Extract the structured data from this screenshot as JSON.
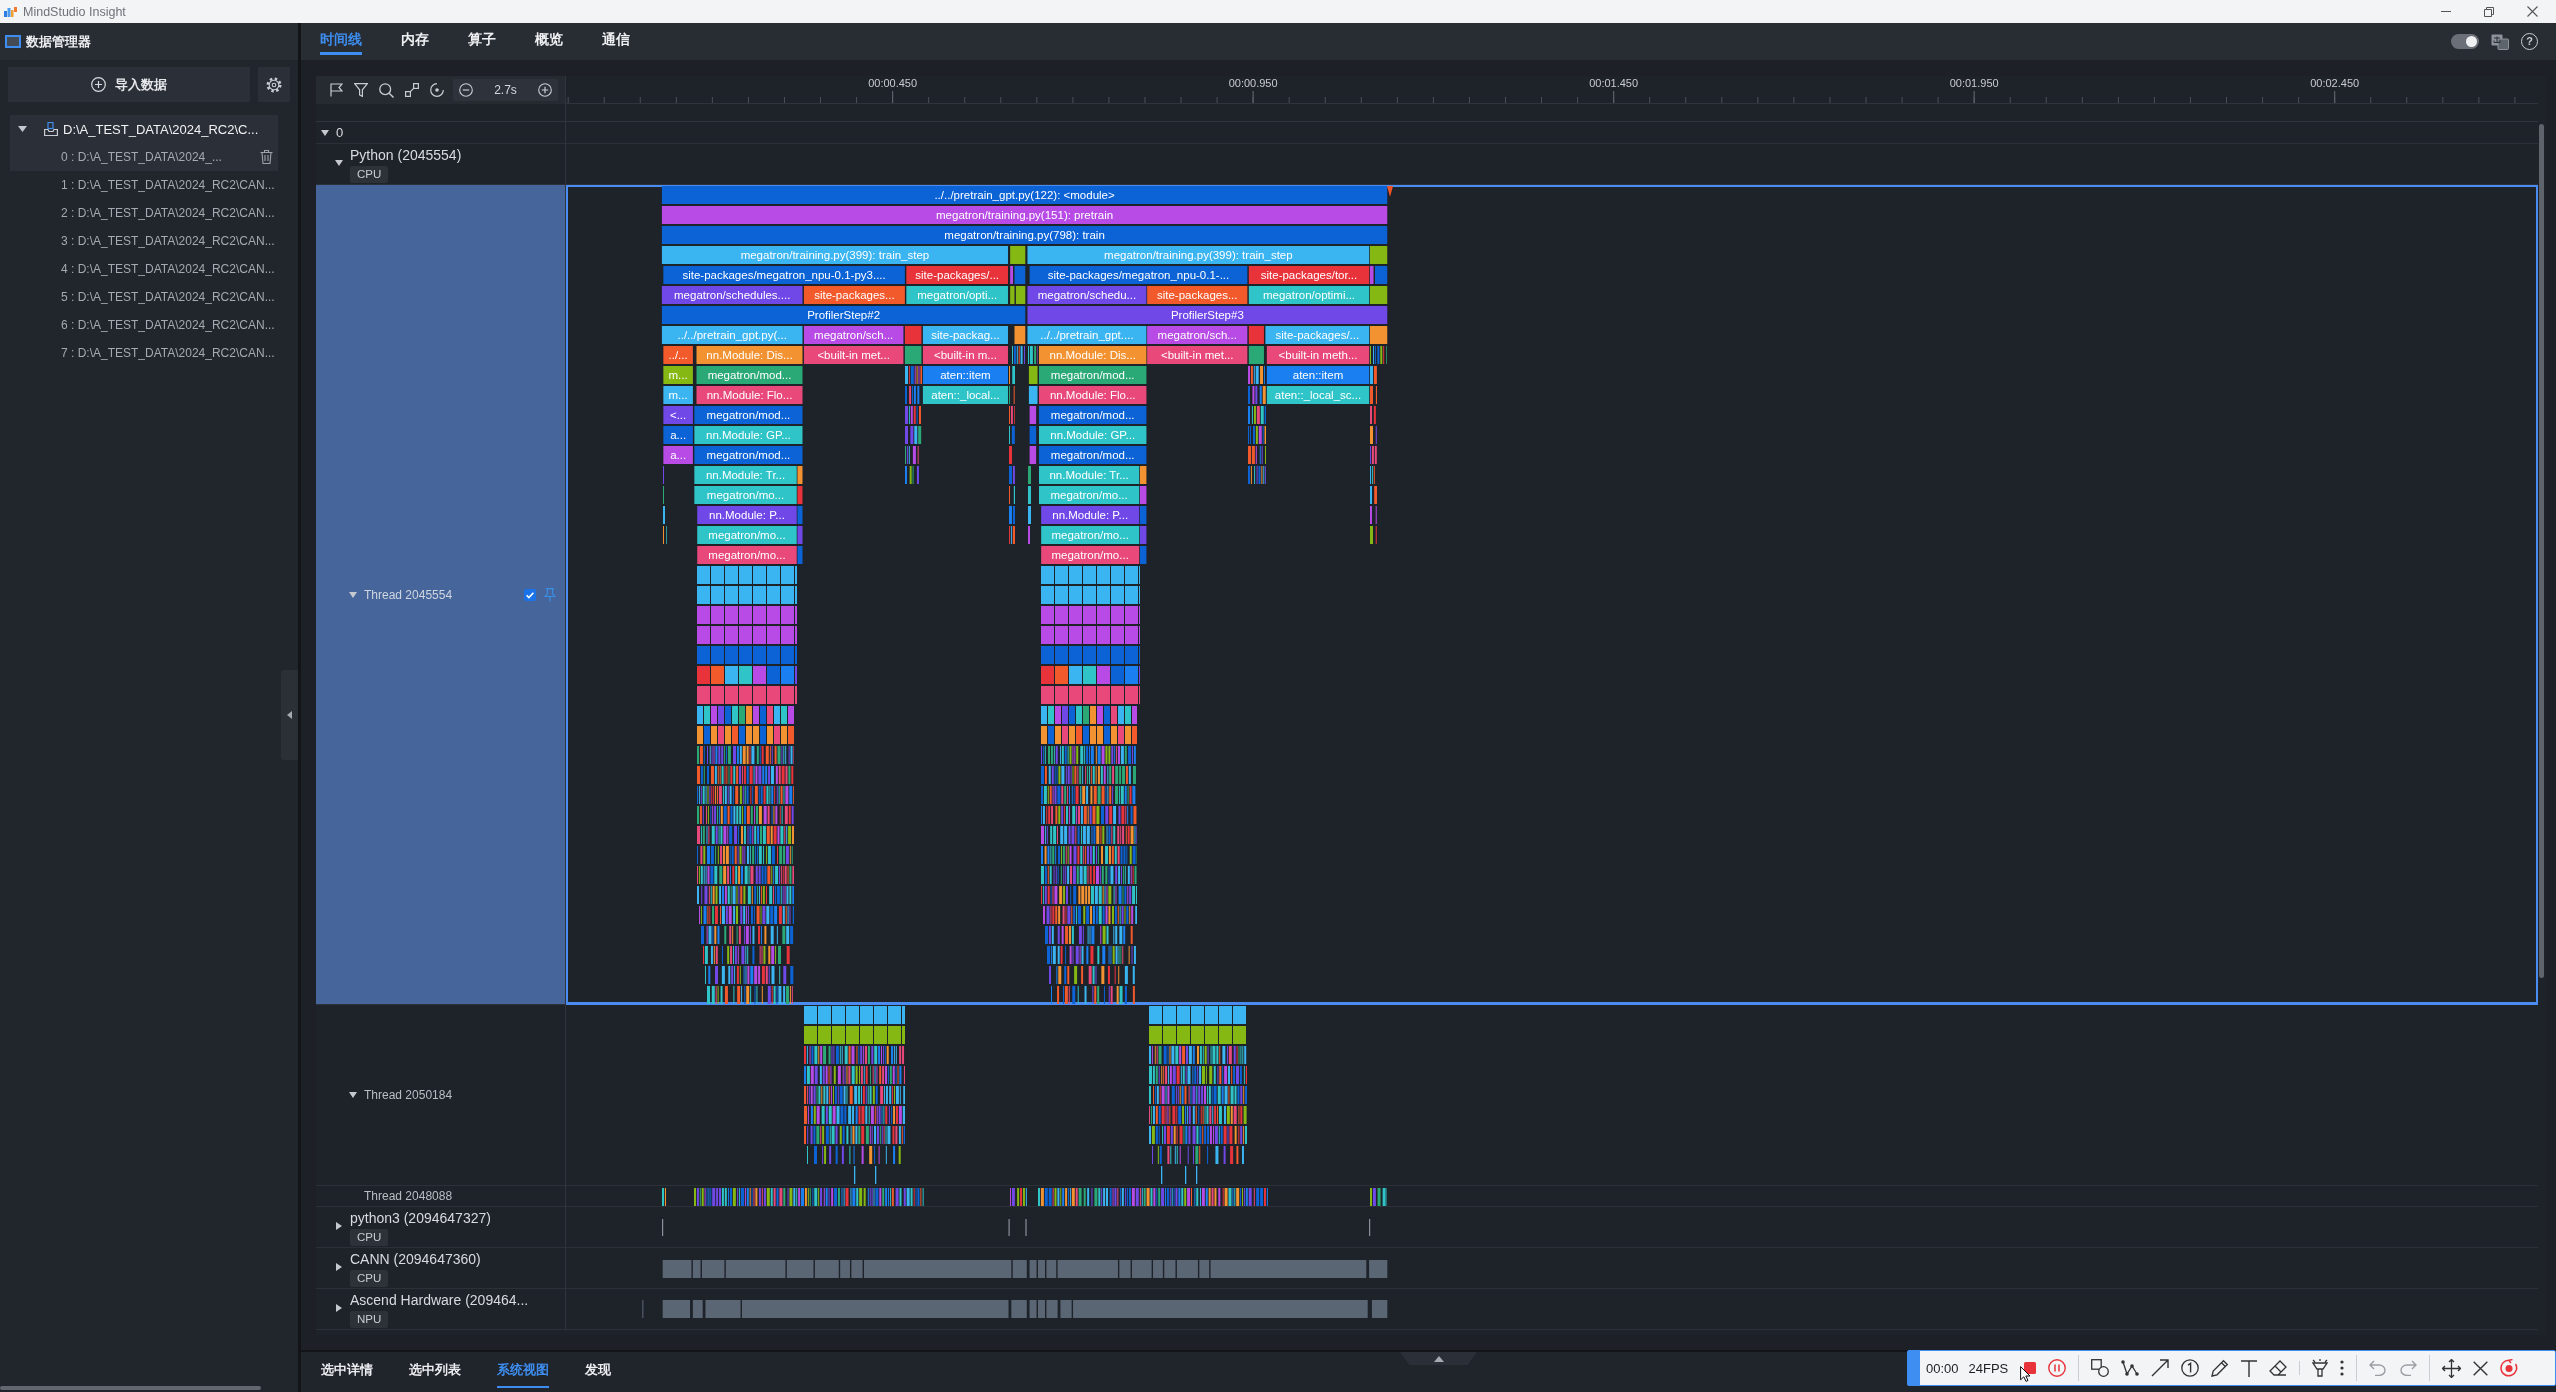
{
  "window": {
    "title": "MindStudio Insight"
  },
  "sidebar": {
    "title": "数据管理器",
    "import_button": "导入数据",
    "tree": [
      {
        "label": "D:\\A_TEST_DATA\\2024_RC2\\C...",
        "expanded": true,
        "children": [
          {
            "label": "0 : D:\\A_TEST_DATA\\2024_...",
            "selected": true
          },
          {
            "label": "1 : D:\\A_TEST_DATA\\2024_RC2\\CAN...",
            "selected": false
          },
          {
            "label": "2 : D:\\A_TEST_DATA\\2024_RC2\\CAN...",
            "selected": false
          },
          {
            "label": "3 : D:\\A_TEST_DATA\\2024_RC2\\CAN...",
            "selected": false
          },
          {
            "label": "4 : D:\\A_TEST_DATA\\2024_RC2\\CAN...",
            "selected": false
          },
          {
            "label": "5 : D:\\A_TEST_DATA\\2024_RC2\\CAN...",
            "selected": false
          },
          {
            "label": "6 : D:\\A_TEST_DATA\\2024_RC2\\CAN...",
            "selected": false
          },
          {
            "label": "7 : D:\\A_TEST_DATA\\2024_RC2\\CAN...",
            "selected": false
          }
        ]
      }
    ]
  },
  "tabs": [
    {
      "label": "时间线",
      "selected": true
    },
    {
      "label": "内存",
      "selected": false
    },
    {
      "label": "算子",
      "selected": false
    },
    {
      "label": "概览",
      "selected": false
    },
    {
      "label": "通信",
      "selected": false
    }
  ],
  "theme_switch": {
    "on": true
  },
  "help_button": "?",
  "timeline": {
    "zoom": "2.7s",
    "ruler_ticks": [
      "00:00.450",
      "00:00.950",
      "00:01.450",
      "00:01.950",
      "00:02.450"
    ],
    "rows": [
      {
        "kind": "group",
        "label": "0",
        "expanded": true,
        "selected": false,
        "children": [
          {
            "kind": "process",
            "label": "Python (2045554)",
            "badge": "CPU",
            "expanded": true,
            "selected": false,
            "children": [
              {
                "kind": "thread",
                "label": "Thread 2045554",
                "expanded": true,
                "selected": true,
                "checked": true,
                "lanes": [
                  {
                    "slices": [
                      {
                        "label": "../../pretrain_gpt.py(122): <module>",
                        "color": "#0b63d6"
                      }
                    ]
                  },
                  {
                    "slices": [
                      {
                        "label": "megatron/training.py(151): pretrain",
                        "color": "#b84ae6"
                      }
                    ]
                  },
                  {
                    "slices": [
                      {
                        "label": "megatron/training.py(798): train",
                        "color": "#0b63d6"
                      }
                    ]
                  },
                  {
                    "slices": [
                      {
                        "label": "megatron/training.py(399): train_step",
                        "color": "#3bb4f2"
                      },
                      {
                        "color": "#86b813"
                      },
                      {
                        "label": "megatron/training.py(399): train_step",
                        "color": "#3bb4f2"
                      },
                      {
                        "color": "#86b813"
                      }
                    ]
                  },
                  {
                    "slices": [
                      {
                        "label": "site-packages/megatron_npu-0.1-py3....",
                        "color": "#0b63d6"
                      },
                      {
                        "label": "site-packages/...",
                        "color": "#e8333b"
                      },
                      {
                        "color": "#b84ae6"
                      },
                      {
                        "color": "#0b63d6"
                      },
                      {
                        "label": "site-packages/megatron_npu-0.1-...",
                        "color": "#0b63d6"
                      },
                      {
                        "label": "site-packages/tor...",
                        "color": "#e8333b"
                      },
                      {
                        "color": "#b84ae6"
                      },
                      {
                        "color": "#0b63d6"
                      }
                    ]
                  },
                  {
                    "slices": [
                      {
                        "label": "megatron/schedules....",
                        "color": "#7048e8"
                      },
                      {
                        "label": "site-packages...",
                        "color": "#f25a2c"
                      },
                      {
                        "label": "megatron/opti...",
                        "color": "#2ec4c8"
                      },
                      {
                        "color": "#86b813"
                      },
                      {
                        "color": "#86b813"
                      },
                      {
                        "label": "megatron/schedu...",
                        "color": "#7048e8"
                      },
                      {
                        "label": "site-packages...",
                        "color": "#f25a2c"
                      },
                      {
                        "label": "megatron/optimi...",
                        "color": "#2ec4c8"
                      },
                      {
                        "color": "#86b813"
                      }
                    ]
                  },
                  {
                    "slices": [
                      {
                        "label": "ProfilerStep#2",
                        "color": "#0b63d6"
                      },
                      {
                        "label": "ProfilerStep#3",
                        "color": "#7048e8"
                      }
                    ]
                  },
                  {
                    "slices": [
                      {
                        "label": "../../pretrain_gpt.py(...",
                        "color": "#3bb4f2"
                      },
                      {
                        "label": "megatron/sch...",
                        "color": "#b84ae6"
                      },
                      {
                        "color": "#e8333b"
                      },
                      {
                        "label": "site-packag...",
                        "color": "#3bb4f2"
                      },
                      {
                        "color": "#f29230"
                      },
                      {
                        "label": "../../pretrain_gpt....",
                        "color": "#3bb4f2"
                      },
                      {
                        "label": "megatron/sch...",
                        "color": "#b84ae6"
                      },
                      {
                        "color": "#e8333b"
                      },
                      {
                        "label": "site-packages/...",
                        "color": "#3bb4f2"
                      },
                      {
                        "color": "#f29230"
                      }
                    ]
                  },
                  {
                    "slices": [
                      {
                        "label": "../...",
                        "color": "#f25a2c"
                      },
                      {
                        "label": "nn.Module: Dis...",
                        "color": "#f29230"
                      },
                      {
                        "label": "<built-in met...",
                        "color": "#e8487a"
                      },
                      {
                        "color": "#2aa876"
                      },
                      {
                        "label": "<built-in m...",
                        "color": "#e8487a"
                      },
                      {
                        "label": "nn.Module: Dis...",
                        "color": "#f29230"
                      },
                      {
                        "label": "<built-in met...",
                        "color": "#e8487a"
                      },
                      {
                        "color": "#2aa876"
                      },
                      {
                        "label": "<built-in meth...",
                        "color": "#e8487a"
                      }
                    ]
                  },
                  {
                    "slices": [
                      {
                        "label": "m...",
                        "color": "#86b813"
                      },
                      {
                        "label": "megatron/mod...",
                        "color": "#2aa876"
                      },
                      {
                        "label": "aten::item",
                        "color": "#1a7ff0"
                      },
                      {
                        "color": "#86b813"
                      },
                      {
                        "label": "megatron/mod...",
                        "color": "#2aa876"
                      },
                      {
                        "label": "aten::item",
                        "color": "#1a7ff0"
                      }
                    ]
                  },
                  {
                    "slices": [
                      {
                        "label": "m...",
                        "color": "#3bb4f2"
                      },
                      {
                        "label": "nn.Module: Flo...",
                        "color": "#e8487a"
                      },
                      {
                        "label": "aten::_local...",
                        "color": "#2ec4c8"
                      },
                      {
                        "color": "#3bb4f2"
                      },
                      {
                        "label": "nn.Module: Flo...",
                        "color": "#e8487a"
                      },
                      {
                        "label": "aten::_local_sc...",
                        "color": "#2ec4c8"
                      }
                    ]
                  },
                  {
                    "slices": [
                      {
                        "label": "<...",
                        "color": "#7048e8"
                      },
                      {
                        "label": "megatron/mod...",
                        "color": "#0b63d6"
                      },
                      {
                        "color": "#b84ae6"
                      },
                      {
                        "label": "megatron/mod...",
                        "color": "#0b63d6"
                      }
                    ]
                  },
                  {
                    "slices": [
                      {
                        "label": "a...",
                        "color": "#0b63d6"
                      },
                      {
                        "label": "nn.Module: GP...",
                        "color": "#2ec4c8"
                      },
                      {
                        "color": "#0b63d6"
                      },
                      {
                        "label": "nn.Module: GP...",
                        "color": "#2ec4c8"
                      }
                    ]
                  },
                  {
                    "slices": [
                      {
                        "label": "a...",
                        "color": "#b84ae6"
                      },
                      {
                        "label": "megatron/mod...",
                        "color": "#0b63d6"
                      },
                      {
                        "color": "#b84ae6"
                      },
                      {
                        "label": "megatron/mod...",
                        "color": "#0b63d6"
                      }
                    ]
                  },
                  {
                    "slices": [
                      {
                        "label": "nn.Module: Tr...",
                        "color": "#2ec4c8"
                      },
                      {
                        "color": "#f29230"
                      },
                      {
                        "label": "nn.Module: Tr...",
                        "color": "#2ec4c8"
                      },
                      {
                        "color": "#f29230"
                      }
                    ]
                  },
                  {
                    "slices": [
                      {
                        "label": "megatron/mo...",
                        "color": "#2ec4c8"
                      },
                      {
                        "color": "#e8333b"
                      },
                      {
                        "label": "megatron/mo...",
                        "color": "#2ec4c8"
                      },
                      {
                        "color": "#b84ae6"
                      }
                    ]
                  },
                  {
                    "slices": [
                      {
                        "label": "nn.Module: P...",
                        "color": "#7048e8"
                      },
                      {
                        "color": "#0b63d6"
                      },
                      {
                        "label": "nn.Module: P...",
                        "color": "#7048e8"
                      },
                      {
                        "color": "#0b63d6"
                      }
                    ]
                  },
                  {
                    "slices": [
                      {
                        "label": "megatron/mo...",
                        "color": "#2ec4c8"
                      },
                      {
                        "color": "#7048e8"
                      },
                      {
                        "label": "megatron/mo...",
                        "color": "#2ec4c8"
                      },
                      {
                        "color": "#7048e8"
                      }
                    ]
                  },
                  {
                    "slices": [
                      {
                        "label": "megatron/mo...",
                        "color": "#e8487a"
                      },
                      {
                        "color": "#0b63d6"
                      },
                      {
                        "label": "megatron/mo...",
                        "color": "#e8487a"
                      },
                      {
                        "color": "#0b63d6"
                      }
                    ]
                  }
                ]
              },
              {
                "kind": "thread",
                "label": "Thread 2050184",
                "expanded": true,
                "selected": false
              },
              {
                "kind": "thread",
                "label": "Thread 2048088",
                "selected": false
              }
            ]
          },
          {
            "kind": "process",
            "label": "python3 (2094647327)",
            "badge": "CPU",
            "expanded": false,
            "selected": false
          },
          {
            "kind": "process",
            "label": "CANN (2094647360)",
            "badge": "CPU",
            "expanded": false,
            "selected": false
          },
          {
            "kind": "process",
            "label": "Ascend Hardware (209464...",
            "badge": "NPU",
            "expanded": false,
            "selected": false
          }
        ]
      }
    ]
  },
  "bottom_tabs": [
    {
      "label": "选中详情",
      "selected": false
    },
    {
      "label": "选中列表",
      "selected": false
    },
    {
      "label": "系统视图",
      "selected": true
    },
    {
      "label": "发现",
      "selected": false
    }
  ],
  "recorder": {
    "time": "00:00",
    "frame_rate": "24FPS"
  }
}
